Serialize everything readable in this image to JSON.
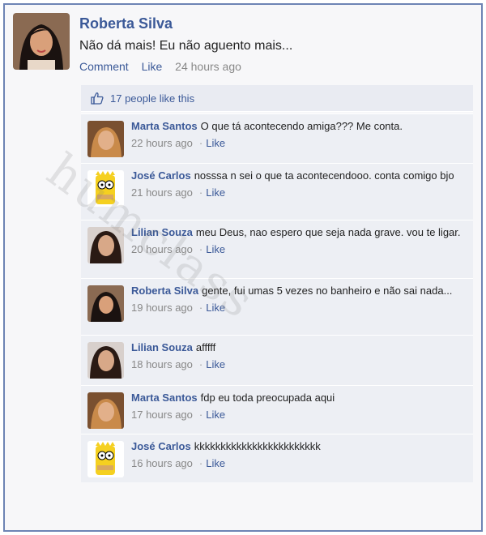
{
  "post": {
    "author": "Roberta Silva",
    "text": "Não dá mais! Eu não aguento mais...",
    "comment_label": "Comment",
    "like_label": "Like",
    "time": "24 hours ago"
  },
  "likes": {
    "text": "17 people like this",
    "icon": "thumbs-up-icon"
  },
  "comments": [
    {
      "name": "Marta Santos",
      "text": "O que tá acontecendo amiga??? Me conta.",
      "time": "22 hours ago",
      "like": "Like"
    },
    {
      "name": "José Carlos",
      "text": "nosssa n sei o que ta acontecendooo. conta comigo bjo",
      "time": "21 hours ago",
      "like": "Like"
    },
    {
      "name": "Lilian Souza",
      "text": "meu Deus, nao espero que seja nada grave. vou te ligar.",
      "time": "20 hours ago",
      "like": "Like"
    },
    {
      "name": "Roberta Silva",
      "text": "gente, fui umas 5 vezes no banheiro e não sai nada...",
      "time": "19 hours ago",
      "like": "Like"
    },
    {
      "name": "Lilian Souza",
      "text": "afffff",
      "time": "18 hours ago",
      "like": "Like"
    },
    {
      "name": "Marta Santos",
      "text": "fdp eu toda preocupada aqui",
      "time": "17 hours ago",
      "like": "Like"
    },
    {
      "name": "José Carlos",
      "text": "kkkkkkkkkkkkkkkkkkkkkkkk",
      "time": "16 hours ago",
      "like": "Like"
    }
  ],
  "watermark": "humclass",
  "colors": {
    "link": "#3b5998",
    "comment_bg": "#edeff4",
    "likes_bg": "#e9ebf2"
  }
}
